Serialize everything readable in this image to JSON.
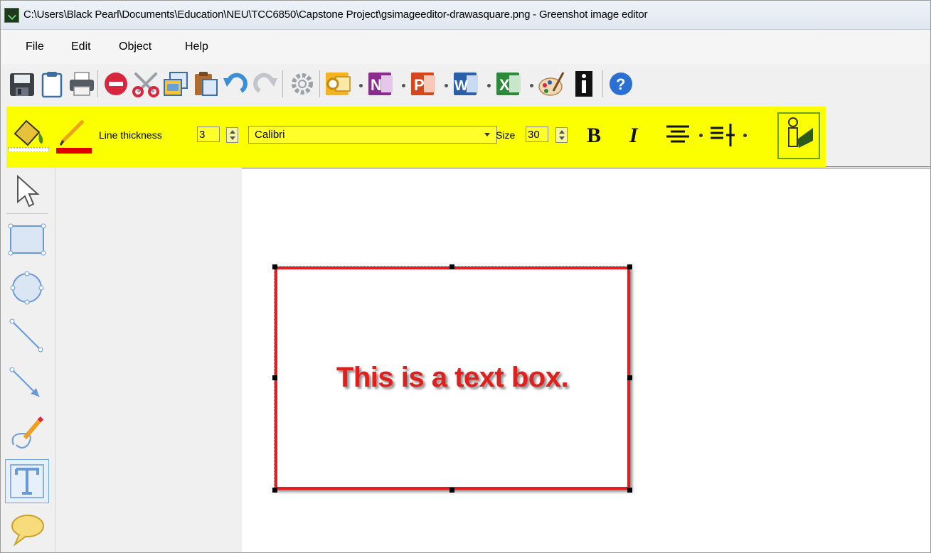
{
  "window": {
    "title": "C:\\Users\\Black Pearl\\Documents\\Education\\NEU\\TCC6850\\Capstone Project\\gsimageeditor-drawasquare.png - Greenshot image editor",
    "app_icon": "greenshot-app-icon"
  },
  "menu": {
    "items": [
      {
        "label": "File"
      },
      {
        "label": "Edit"
      },
      {
        "label": "Object"
      },
      {
        "label": "Help"
      }
    ]
  },
  "toolbar": {
    "buttons": [
      {
        "icon": "save-icon"
      },
      {
        "icon": "clipboard-icon"
      },
      {
        "icon": "print-icon"
      },
      {
        "icon": "delete-icon"
      },
      {
        "icon": "cut-icon"
      },
      {
        "icon": "copy-icon"
      },
      {
        "icon": "paste-icon"
      },
      {
        "icon": "undo-icon"
      },
      {
        "icon": "redo-icon"
      },
      {
        "icon": "settings-icon"
      },
      {
        "icon": "outlook-icon",
        "accent": "#f2a20c"
      },
      {
        "icon": "onenote-icon",
        "accent": "#8a2d8f"
      },
      {
        "icon": "powerpoint-icon",
        "accent": "#d5471d"
      },
      {
        "icon": "word-icon",
        "accent": "#2b5faa"
      },
      {
        "icon": "excel-icon",
        "accent": "#2c8a3a"
      },
      {
        "icon": "paint-icon"
      },
      {
        "icon": "info-icon"
      },
      {
        "icon": "help-icon",
        "accent": "#2a6fd1"
      }
    ]
  },
  "properties": {
    "background": "#fbff00",
    "line_thickness_label": "Line thickness",
    "line_thickness_value": "3",
    "font_name": "Calibri",
    "size_label": "Size",
    "size_value": "30",
    "line_color": "#e00000"
  },
  "tools": [
    {
      "icon": "pointer-icon"
    },
    {
      "icon": "rectangle-tool-icon"
    },
    {
      "icon": "ellipse-tool-icon"
    },
    {
      "icon": "line-tool-icon"
    },
    {
      "icon": "arrow-tool-icon"
    },
    {
      "icon": "freehand-tool-icon"
    },
    {
      "icon": "text-tool-icon",
      "selected": true
    },
    {
      "icon": "speech-bubble-tool-icon"
    }
  ],
  "canvas": {
    "textbox_text": "This is a text box.",
    "textbox_color": "#e0201c",
    "border_color": "#e02020"
  }
}
